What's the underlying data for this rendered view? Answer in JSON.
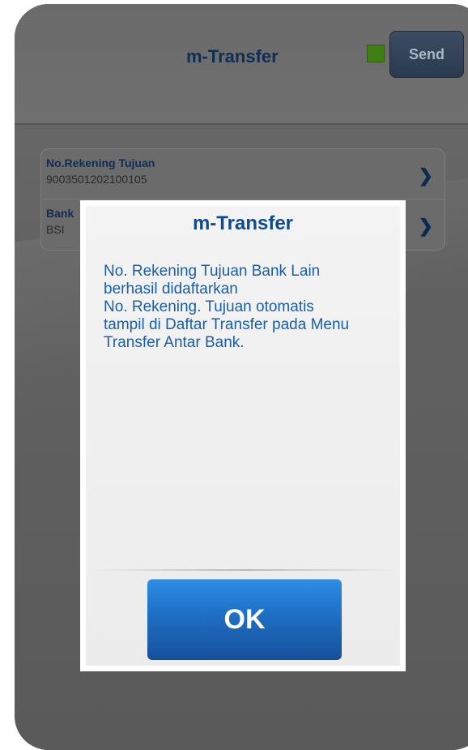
{
  "header": {
    "title": "m-Transfer",
    "send_label": "Send",
    "status_color": "#3f7f13"
  },
  "form": {
    "rows": [
      {
        "label": "No.Rekening Tujuan",
        "value": "9003501202100105",
        "icon": "chevron-right-icon"
      },
      {
        "label": "Bank",
        "value": "BSI",
        "icon": "chevron-right-icon"
      }
    ]
  },
  "dialog": {
    "title": "m-Transfer",
    "message_lines": [
      "No. Rekening Tujuan Bank Lain",
      "berhasil didaftarkan",
      "No. Rekening. Tujuan otomatis",
      "tampil di Daftar Transfer pada Menu",
      "Transfer Antar Bank."
    ],
    "ok_label": "OK"
  },
  "colors": {
    "accent": "#1f6fc4",
    "title_text": "#0d4a93",
    "message_text": "#1a5fa7"
  }
}
